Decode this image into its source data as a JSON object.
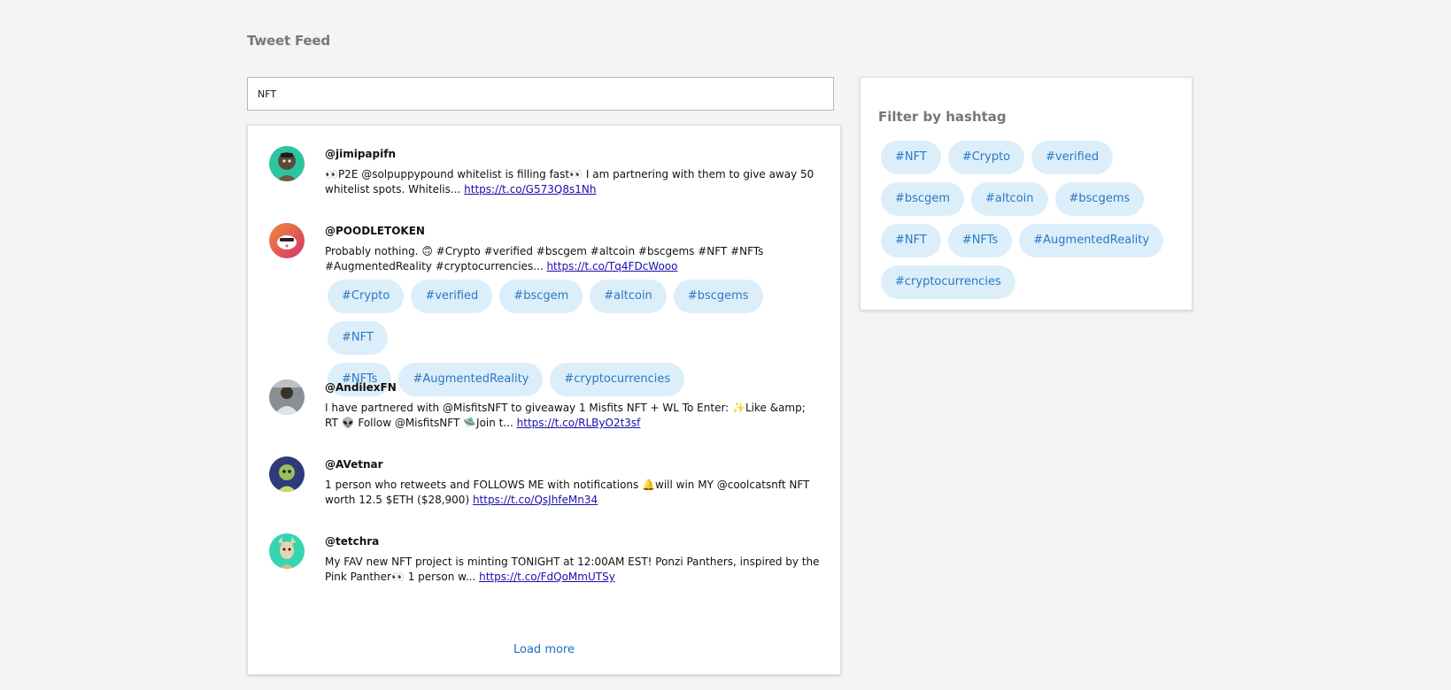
{
  "page": {
    "title": "Tweet Feed"
  },
  "search": {
    "value": "NFT"
  },
  "tweets": [
    {
      "handle": "@jimipapifn",
      "text": "👀P2E @solpuppypound whitelist is filling fast👀 I am partnering with them to give away 50 whitelist spots. Whitelis... ",
      "link": "https://t.co/G573Q8s1Nh",
      "hashtags": []
    },
    {
      "handle": "@POODLETOKEN",
      "text": "Probably nothing. 🙃 #Crypto #verified #bscgem #altcoin #bscgems #NFT #NFTs #AugmentedReality #cryptocurrencies... ",
      "link": "https://t.co/Tq4FDcWooo",
      "hashtags": [
        "#Crypto",
        "#verified",
        "#bscgem",
        "#altcoin",
        "#bscgems",
        "#NFT",
        "#NFTs",
        "#AugmentedReality",
        "#cryptocurrencies"
      ]
    },
    {
      "handle": "@AndilexFN",
      "text": "I have partnered with @MisfitsNFT to giveaway 1 Misfits NFT + WL To Enter: ✨Like &amp; RT 👽 Follow @MisfitsNFT 🛸Join t... ",
      "link": "https://t.co/RLByO2t3sf",
      "hashtags": []
    },
    {
      "handle": "@AVetnar",
      "text": "1 person who retweets and FOLLOWS ME with notifications 🔔will win MY @coolcatsnft NFT worth 12.5 $ETH ($28,900) ",
      "link": "https://t.co/QsJhfeMn34",
      "hashtags": []
    },
    {
      "handle": "@tetchra",
      "text": "My FAV new NFT project is minting TONIGHT at 12:00AM EST! Ponzi Panthers, inspired by the Pink Panther👀 1 person w... ",
      "link": "https://t.co/FdQoMmUTSy",
      "hashtags": []
    }
  ],
  "load_more_label": "Load more",
  "filter": {
    "title": "Filter by hashtag",
    "hashtags": [
      "#NFT",
      "#Crypto",
      "#verified",
      "#bscgem",
      "#altcoin",
      "#bscgems",
      "#NFT",
      "#NFTs",
      "#AugmentedReality",
      "#cryptocurrencies"
    ]
  },
  "colors": {
    "chip_bg": "#dceefa",
    "chip_text": "#2a79c2",
    "link": "#1a0dab",
    "load_more": "#1f6fc0"
  }
}
